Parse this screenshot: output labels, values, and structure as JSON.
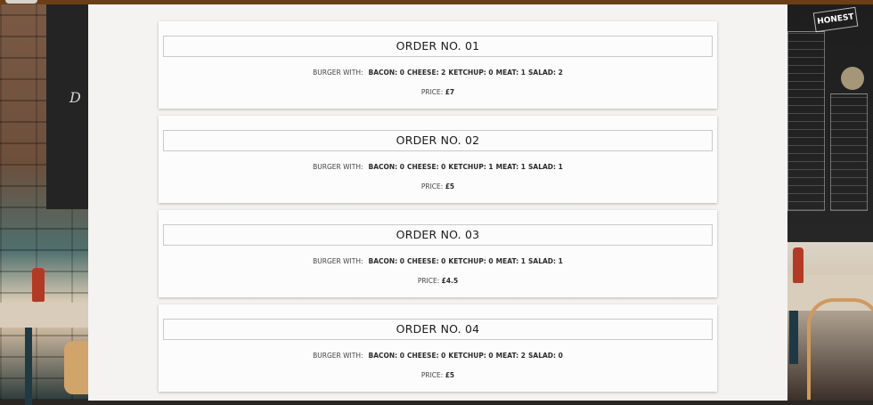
{
  "orders": [
    {
      "title": "ORDER NO. 01",
      "prefix": "BURGER WITH:",
      "ingredients": [
        "BACON: 0",
        "CHEESE: 2",
        "KETCHUP: 0",
        "MEAT: 1",
        "SALAD: 2"
      ],
      "price_label": "PRICE:",
      "price_value": "£7"
    },
    {
      "title": "ORDER NO. 02",
      "prefix": "BURGER WITH:",
      "ingredients": [
        "BACON: 0",
        "CHEESE: 0",
        "KETCHUP: 1",
        "MEAT: 1",
        "SALAD: 1"
      ],
      "price_label": "PRICE:",
      "price_value": "£5"
    },
    {
      "title": "ORDER NO. 03",
      "prefix": "BURGER WITH:",
      "ingredients": [
        "BACON: 0",
        "CHEESE: 0",
        "KETCHUP: 0",
        "MEAT: 1",
        "SALAD: 1"
      ],
      "price_label": "PRICE:",
      "price_value": "£4.5"
    },
    {
      "title": "ORDER NO. 04",
      "prefix": "BURGER WITH:",
      "ingredients": [
        "BACON: 0",
        "CHEESE: 0",
        "KETCHUP: 0",
        "MEAT: 2",
        "SALAD: 0"
      ],
      "price_label": "PRICE:",
      "price_value": "£5"
    }
  ],
  "background": {
    "sign_text": "HONEST"
  },
  "colors": {
    "top_bar": "#6b3f16",
    "panel": "#f3f2f1",
    "title_text": "#1b1b1b"
  }
}
